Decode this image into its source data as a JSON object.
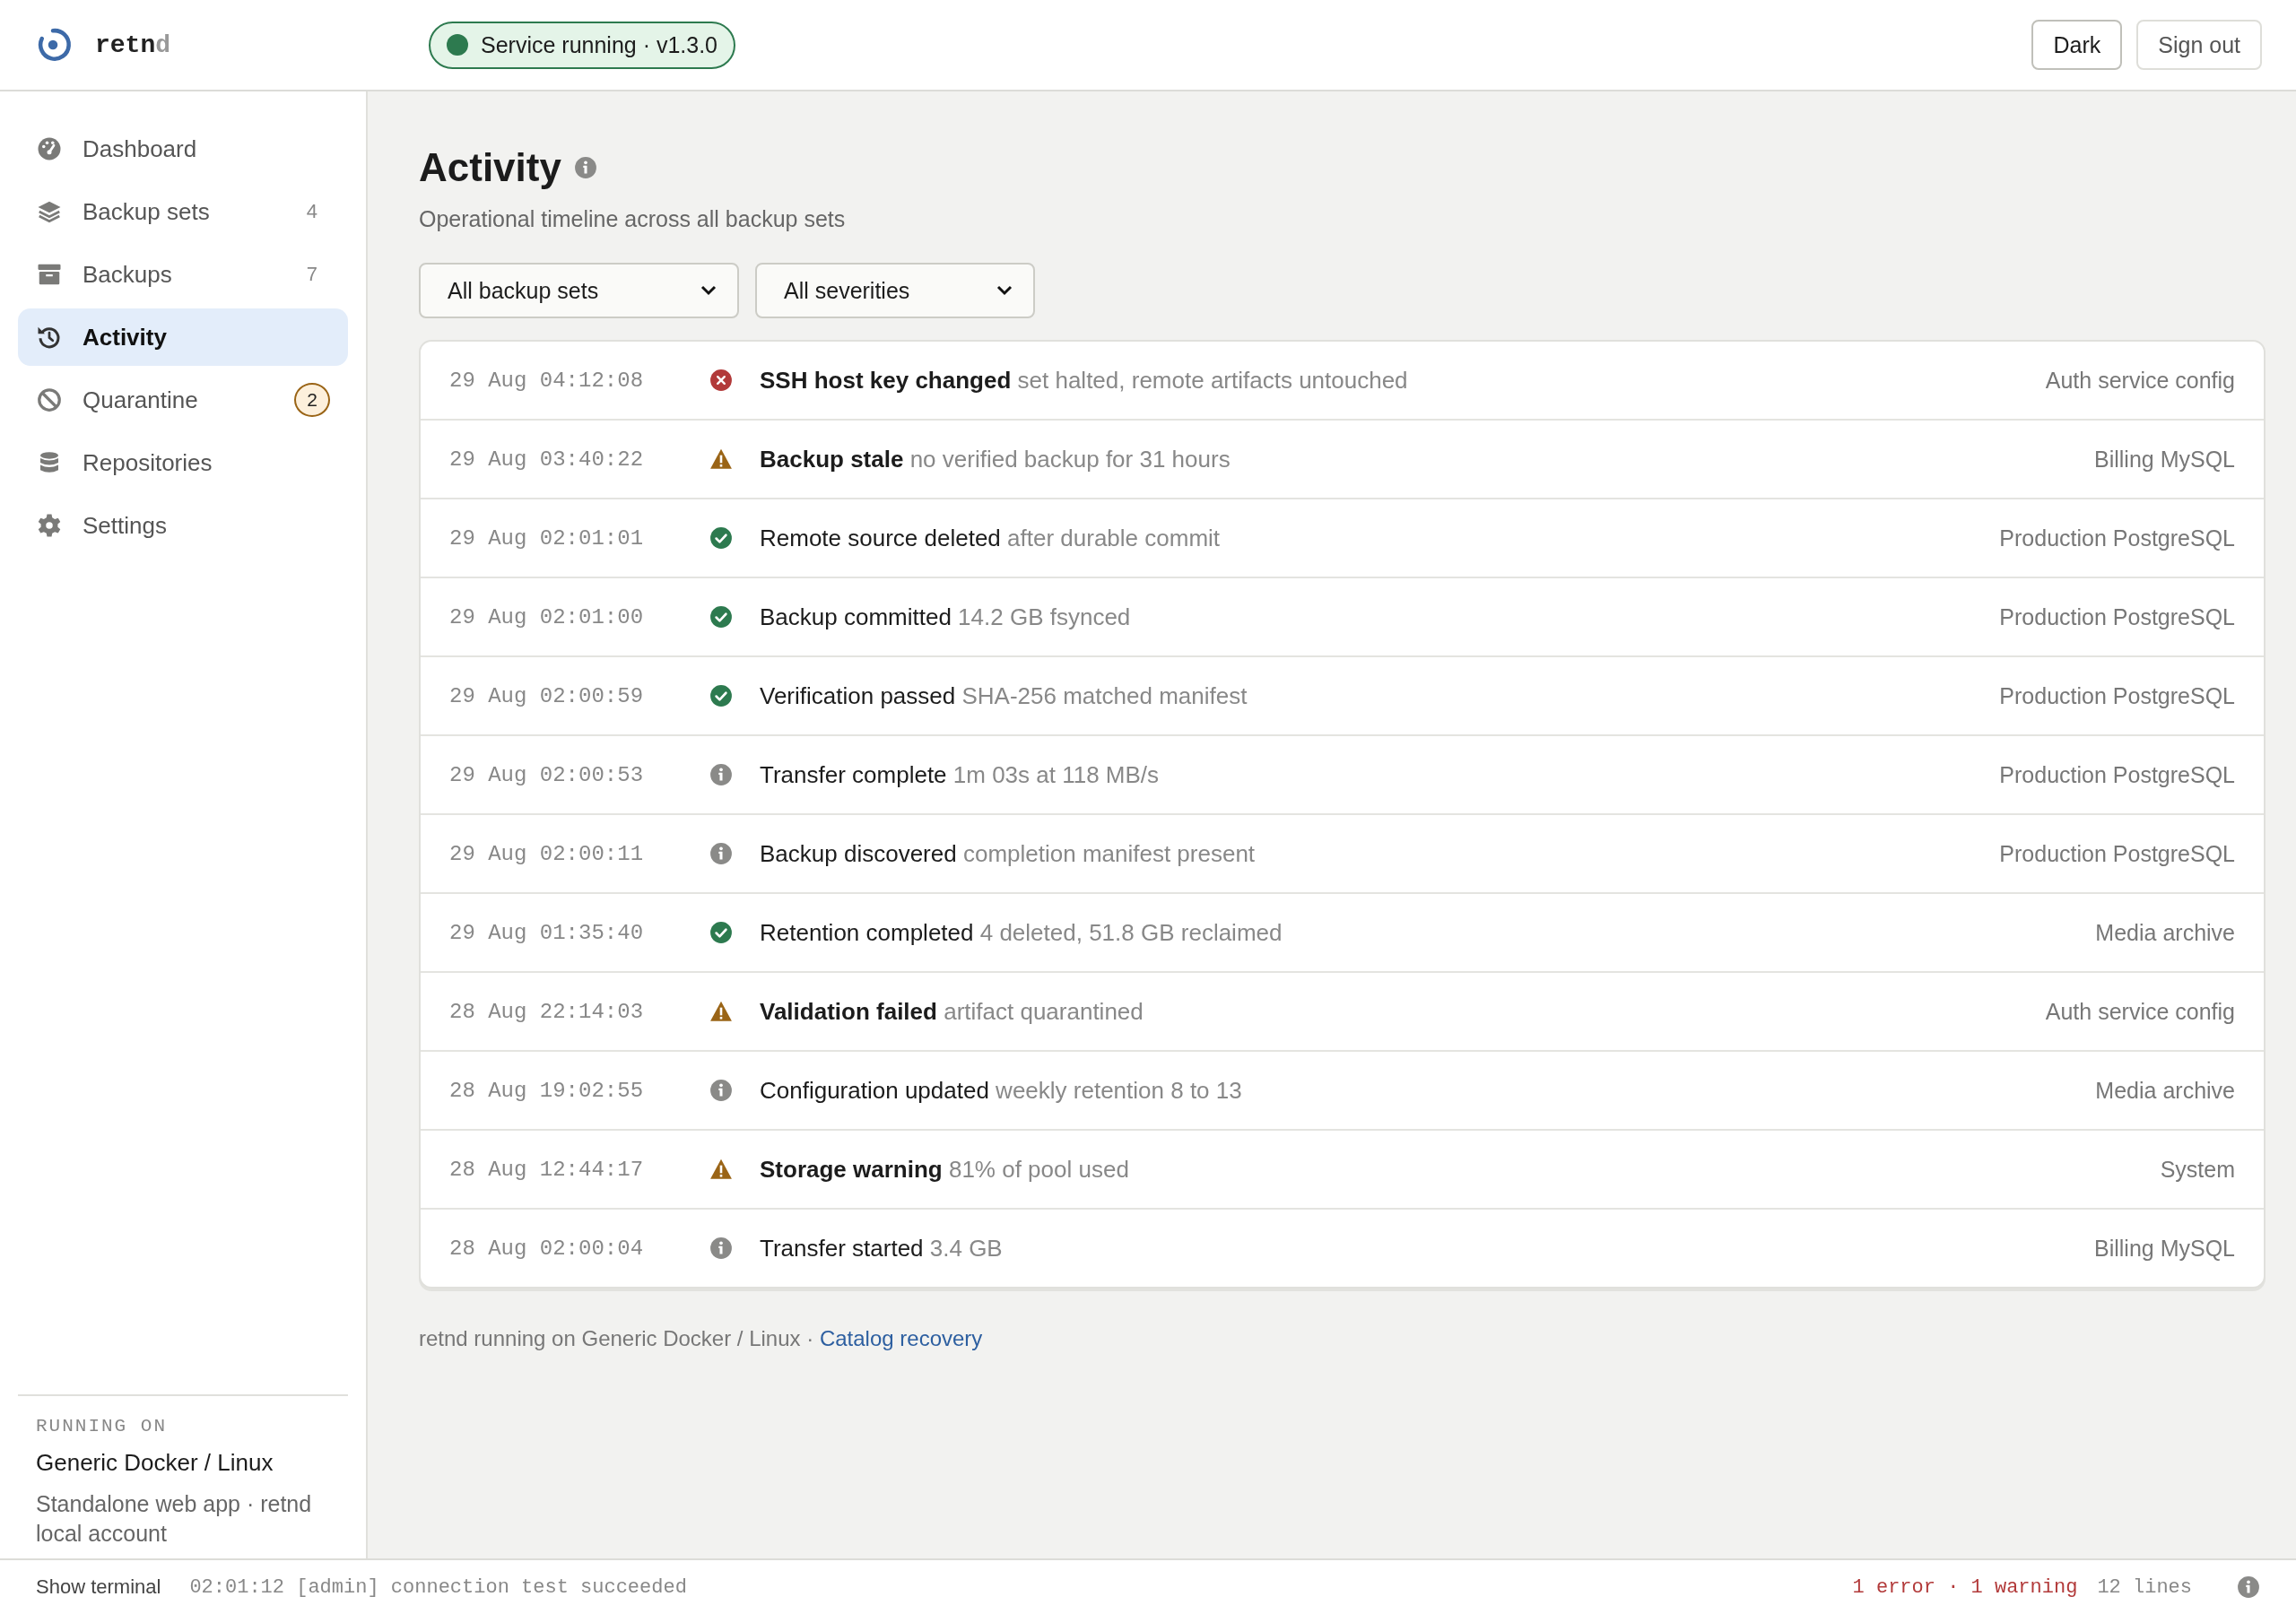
{
  "brand": {
    "name": "retn",
    "name_dim": "d"
  },
  "status_pill": {
    "text": "Service running · v1.3.0",
    "running": true
  },
  "header_buttons": [
    {
      "label": "Dark",
      "kind": "primary"
    },
    {
      "label": "Sign out",
      "kind": "secondary"
    }
  ],
  "sidebar": {
    "items": [
      {
        "label": "Dashboard",
        "selected": false
      },
      {
        "label": "Backup sets",
        "count": "4",
        "selected": false
      },
      {
        "label": "Backups",
        "count": "7",
        "selected": false
      },
      {
        "label": "Activity",
        "selected": true
      },
      {
        "label": "Quarantine",
        "badge": "2",
        "selected": false
      },
      {
        "label": "Repositories",
        "selected": false
      },
      {
        "label": "Settings",
        "selected": false
      }
    ],
    "footer": {
      "caption": "RUNNING ON",
      "platform": "Generic Docker / Linux",
      "detail": "Standalone web app · retnd local account"
    }
  },
  "page": {
    "title": "Activity",
    "subtitle": "Operational timeline across all backup sets",
    "filters": [
      {
        "value": "All backup sets"
      },
      {
        "value": "All severities"
      }
    ],
    "events": [
      {
        "time": "29 Aug 04:12:08",
        "kind": "error",
        "title": "SSH host key changed",
        "detail": "set halted, remote artifacts untouched",
        "source": "Auth service config"
      },
      {
        "time": "29 Aug 03:40:22",
        "kind": "warning",
        "title": "Backup stale",
        "detail": "no verified backup for 31 hours",
        "source": "Billing MySQL"
      },
      {
        "time": "29 Aug 02:01:01",
        "kind": "success",
        "title": "Remote source deleted",
        "detail": "after durable commit",
        "source": "Production PostgreSQL"
      },
      {
        "time": "29 Aug 02:01:00",
        "kind": "success",
        "title": "Backup committed",
        "detail": "14.2 GB fsynced",
        "source": "Production PostgreSQL"
      },
      {
        "time": "29 Aug 02:00:59",
        "kind": "success",
        "title": "Verification passed",
        "detail": "SHA-256 matched manifest",
        "source": "Production PostgreSQL"
      },
      {
        "time": "29 Aug 02:00:53",
        "kind": "info",
        "title": "Transfer complete",
        "detail": "1m 03s at 118 MB/s",
        "source": "Production PostgreSQL"
      },
      {
        "time": "29 Aug 02:00:11",
        "kind": "info",
        "title": "Backup discovered",
        "detail": "completion manifest present",
        "source": "Production PostgreSQL"
      },
      {
        "time": "29 Aug 01:35:40",
        "kind": "success",
        "title": "Retention completed",
        "detail": "4 deleted, 51.8 GB reclaimed",
        "source": "Media archive"
      },
      {
        "time": "28 Aug 22:14:03",
        "kind": "warning",
        "title": "Validation failed",
        "detail": "artifact quarantined",
        "source": "Auth service config"
      },
      {
        "time": "28 Aug 19:02:55",
        "kind": "info",
        "title": "Configuration updated",
        "detail": "weekly retention 8 to 13",
        "source": "Media archive"
      },
      {
        "time": "28 Aug 12:44:17",
        "kind": "warning",
        "title": "Storage warning",
        "detail": "81% of pool used",
        "source": "System"
      },
      {
        "time": "28 Aug 02:00:04",
        "kind": "info",
        "title": "Transfer started",
        "detail": "3.4 GB",
        "source": "Billing MySQL"
      }
    ],
    "footer": {
      "text": "retnd running on Generic Docker / Linux ·",
      "link": "Catalog recovery"
    }
  },
  "terminal_bar": {
    "toggle": "Show terminal",
    "last_line": "02:01:12 [admin] connection test succeeded",
    "problems": "1 error · 1 warning",
    "lines": "12 lines"
  }
}
